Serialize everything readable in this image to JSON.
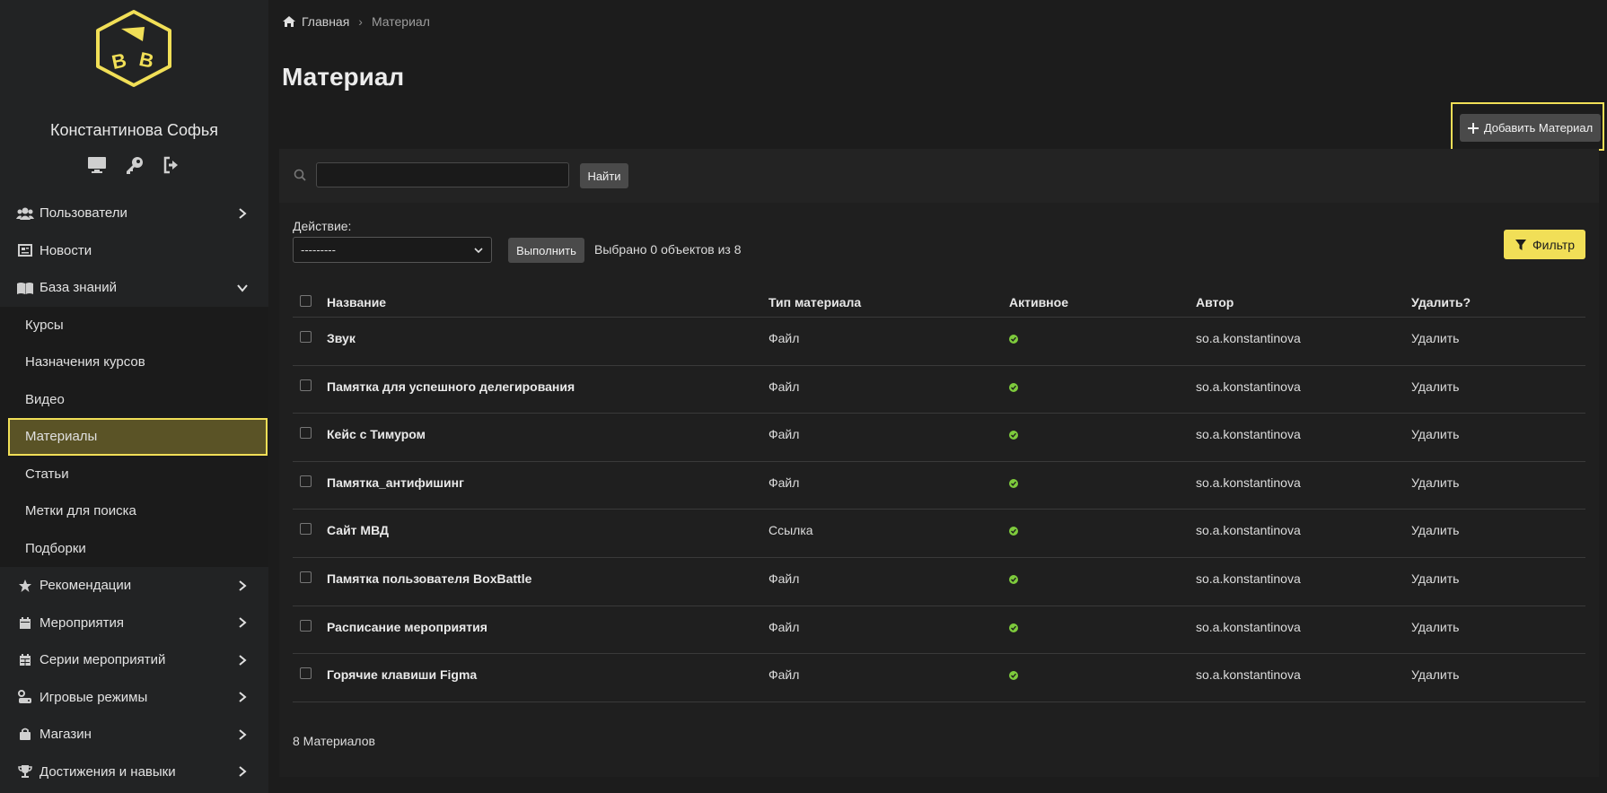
{
  "user": {
    "name": "Константинова Софья"
  },
  "sidebar": {
    "items": [
      {
        "label": "Пользователи",
        "icon": "users-icon"
      },
      {
        "label": "Новости",
        "icon": "newspaper-icon"
      },
      {
        "label": "База знаний",
        "icon": "book-icon"
      }
    ],
    "sub_items": [
      {
        "label": "Курсы"
      },
      {
        "label": "Назначения курсов"
      },
      {
        "label": "Видео"
      },
      {
        "label": "Материалы",
        "active": true
      },
      {
        "label": "Статьи"
      },
      {
        "label": "Метки для поиска"
      },
      {
        "label": "Подборки"
      }
    ],
    "items_after": [
      {
        "label": "Рекомендации",
        "icon": "star-icon"
      },
      {
        "label": "Мероприятия",
        "icon": "calendar-icon"
      },
      {
        "label": "Серии мероприятий",
        "icon": "calendar-series-icon"
      },
      {
        "label": "Игровые режимы",
        "icon": "gamepad-icon"
      },
      {
        "label": "Магазин",
        "icon": "shopping-bag-icon"
      },
      {
        "label": "Достижения и навыки",
        "icon": "trophy-icon"
      }
    ]
  },
  "breadcrumb": {
    "home": "Главная",
    "current": "Материал"
  },
  "page": {
    "title": "Материал",
    "add_button": "Добавить Материал"
  },
  "search": {
    "value": "",
    "button": "Найти"
  },
  "actions": {
    "label": "Действие:",
    "selected": "---------",
    "run_button": "Выполнить",
    "selected_info": "Выбрано 0 объектов из 8",
    "filter_button": "Фильтр"
  },
  "table": {
    "headers": {
      "name": "Название",
      "type": "Тип материала",
      "active": "Активное",
      "author": "Автор",
      "delete": "Удалить?"
    },
    "rows": [
      {
        "name": "Звук",
        "type": "Файл",
        "author": "so.a.konstantinova",
        "delete": "Удалить"
      },
      {
        "name": "Памятка для успешного делегирования",
        "type": "Файл",
        "author": "so.a.konstantinova",
        "delete": "Удалить"
      },
      {
        "name": "Кейс с Тимуром",
        "type": "Файл",
        "author": "so.a.konstantinova",
        "delete": "Удалить"
      },
      {
        "name": "Памятка_антифишинг",
        "type": "Файл",
        "author": "so.a.konstantinova",
        "delete": "Удалить"
      },
      {
        "name": "Сайт МВД",
        "type": "Ссылка",
        "author": "so.a.konstantinova",
        "delete": "Удалить"
      },
      {
        "name": "Памятка пользователя BoxBattle",
        "type": "Файл",
        "author": "so.a.konstantinova",
        "delete": "Удалить"
      },
      {
        "name": "Расписание мероприятия",
        "type": "Файл",
        "author": "so.a.konstantinova",
        "delete": "Удалить"
      },
      {
        "name": "Горячие клавиши Figma",
        "type": "Файл",
        "author": "so.a.konstantinova",
        "delete": "Удалить"
      }
    ],
    "total": "8 Материалов"
  },
  "colors": {
    "accent": "#f1df57",
    "active_green": "#7ecb3c"
  }
}
